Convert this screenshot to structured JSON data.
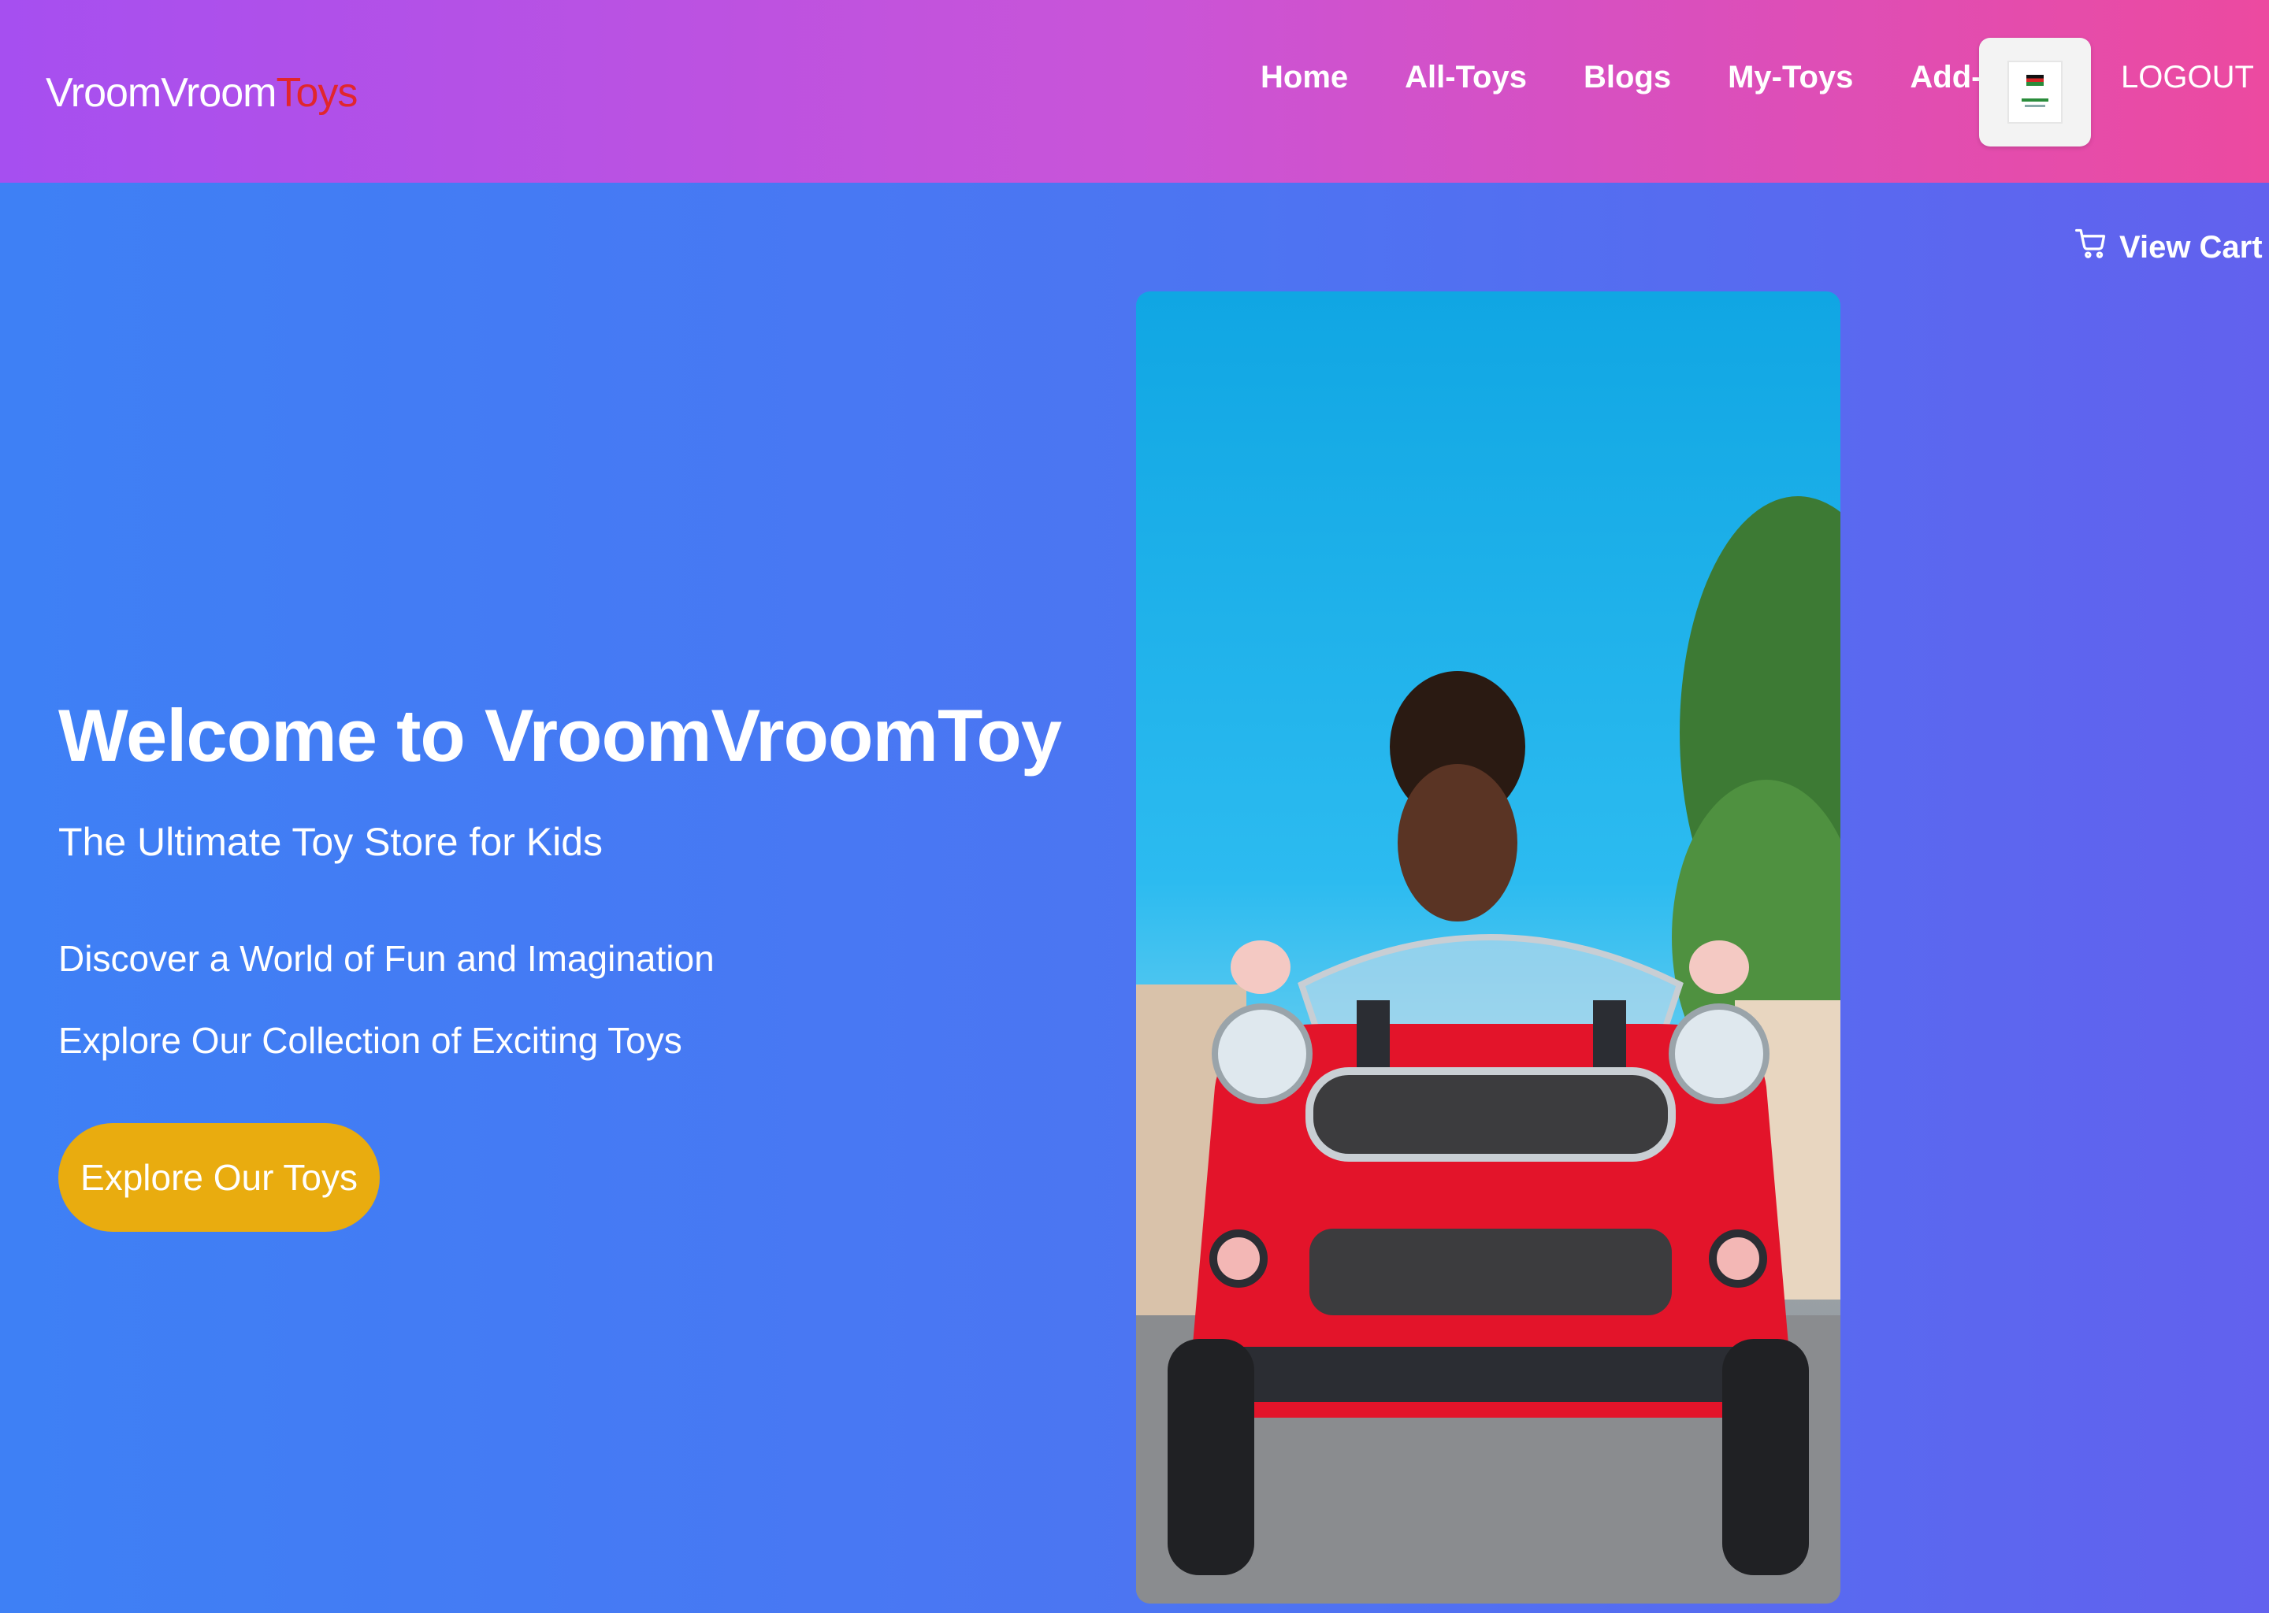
{
  "header": {
    "logo_main": "VroomVroom",
    "logo_accent": "Toys",
    "nav": [
      {
        "label": "Home"
      },
      {
        "label": "All-Toys"
      },
      {
        "label": "Blogs"
      },
      {
        "label": "My-Toys"
      },
      {
        "label": "Add-A-Toy"
      }
    ],
    "logout_label": "LOGOUT"
  },
  "cart": {
    "label": "View Cart",
    "icon": "shopping-cart-icon"
  },
  "hero": {
    "title": "Welcome to VroomVroomToy",
    "subtitle": "The Ultimate Toy Store for Kids",
    "line1": "Discover a World of Fun and Imagination",
    "line2": "Explore Our Collection of Exciting Toys",
    "cta_label": "Explore Our Toys"
  },
  "colors": {
    "header_gradient_start": "#a64ff0",
    "header_gradient_end": "#ec4aa0",
    "body_gradient_start": "#3e80f5",
    "body_gradient_end": "#6261ee",
    "logo_accent": "#e1262d",
    "cta_background": "#e9ac0f"
  }
}
